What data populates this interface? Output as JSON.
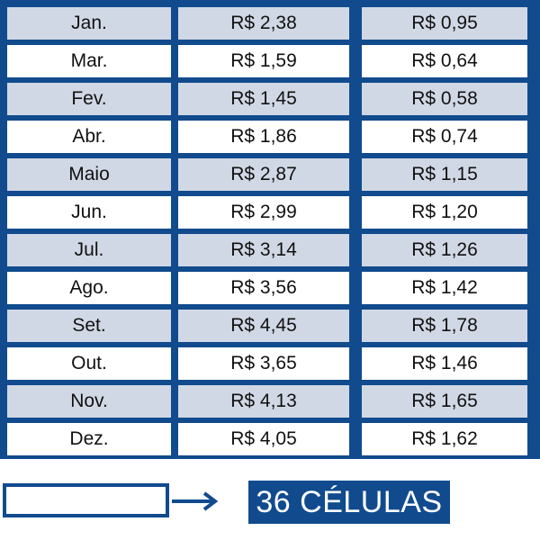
{
  "table": {
    "rows": [
      {
        "month": "Jan.",
        "v1": "R$ 2,38",
        "v2": "R$ 0,95"
      },
      {
        "month": "Mar.",
        "v1": "R$ 1,59",
        "v2": "R$ 0,64"
      },
      {
        "month": "Fev.",
        "v1": "R$ 1,45",
        "v2": "R$ 0,58"
      },
      {
        "month": "Abr.",
        "v1": "R$ 1,86",
        "v2": "R$ 0,74"
      },
      {
        "month": "Maio",
        "v1": "R$ 2,87",
        "v2": "R$ 1,15"
      },
      {
        "month": "Jun.",
        "v1": "R$ 2,99",
        "v2": "R$ 1,20"
      },
      {
        "month": "Jul.",
        "v1": "R$ 3,14",
        "v2": "R$ 1,26"
      },
      {
        "month": "Ago.",
        "v1": "R$ 3,56",
        "v2": "R$ 1,42"
      },
      {
        "month": "Set.",
        "v1": "R$ 4,45",
        "v2": "R$ 1,78"
      },
      {
        "month": "Out.",
        "v1": "R$ 3,65",
        "v2": "R$ 1,46"
      },
      {
        "month": "Nov.",
        "v1": "R$ 4,13",
        "v2": "R$ 1,65"
      },
      {
        "month": "Dez.",
        "v1": "R$ 4,05",
        "v2": "R$ 1,62"
      }
    ]
  },
  "footer": {
    "input_value": "",
    "arrow_icon": "arrow-right-icon",
    "badge_label": "36 CÉLULAS"
  },
  "colors": {
    "border": "#114b8e",
    "alt_row": "#d1d8e5",
    "plain_row": "#ffffff"
  }
}
